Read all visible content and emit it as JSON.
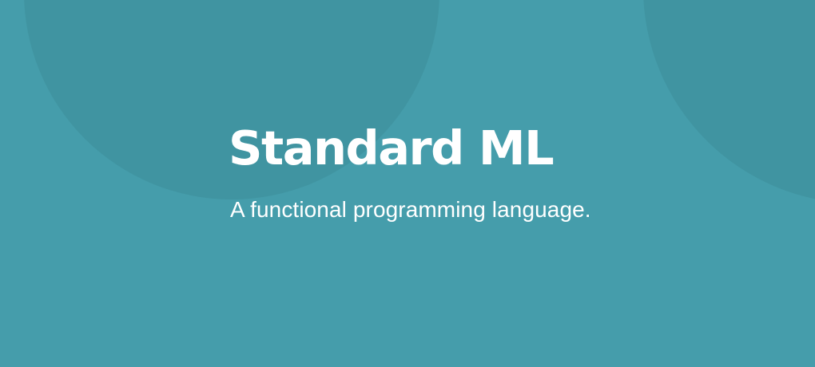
{
  "hero": {
    "title": "Standard ML",
    "subtitle": "A functional programming language."
  },
  "colors": {
    "background": "#459dab",
    "circle": "#3f939f",
    "text": "#ffffff"
  }
}
